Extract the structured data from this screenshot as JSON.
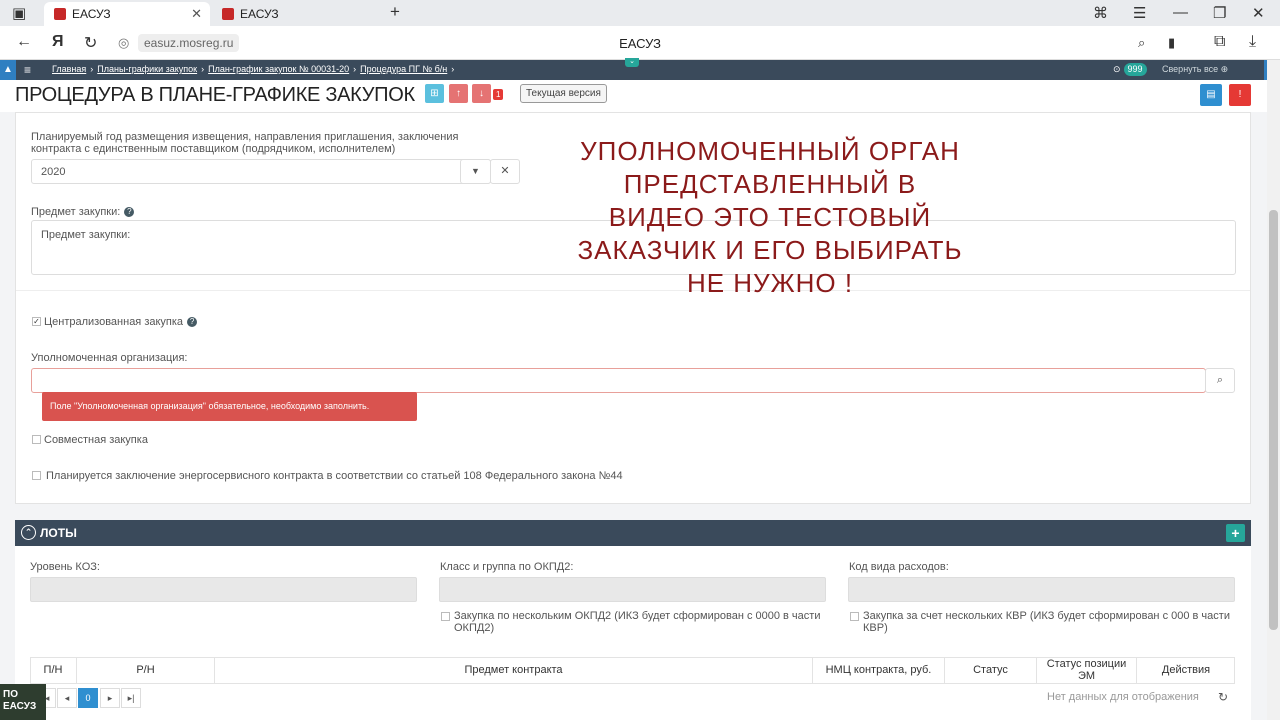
{
  "browser": {
    "tabs": [
      {
        "label": "ЕАСУЗ"
      },
      {
        "label": "ЕАСУЗ"
      }
    ],
    "url": "easuz.mosreg.ru",
    "page_title": "ЕАСУЗ",
    "yandex_label": "Я"
  },
  "appnav": {
    "breadcrumbs": [
      "Главная",
      "Планы-графики закупок",
      "План-график закупок № 00031-20",
      "Процедура ПГ № б/н"
    ],
    "counter": "999",
    "collapse_all": "Свернуть все"
  },
  "header": {
    "title": "ПРОЦЕДУРА В ПЛАНЕ-ГРАФИКЕ ЗАКУПОК",
    "badge_count": "1",
    "version_button": "Текущая версия"
  },
  "form": {
    "year_label": "Планируемый год размещения извещения, направления приглашения, заключения контракта с единственным поставщиком (подрядчиком, исполнителем)",
    "year_value": "2020",
    "subject_label": "Предмет закупки:",
    "subject_placeholder": "Предмет закупки:",
    "centralized_label": "Централизованная закупка",
    "authorized_org_label": "Уполномоченная организация:",
    "error_text": "Поле \"Уполномоченная организация\" обязательное, необходимо заполнить.",
    "joint_label": "Совместная закупка",
    "energy_label": "Планируется заключение энергосервисного контракта в соответствии со статьей 108 Федерального закона №44"
  },
  "overlay_text": [
    "УПОЛНОМОЧЕННЫЙ ОРГАН",
    "ПРЕДСТАВЛЕННЫЙ В",
    "ВИДЕО ЭТО ТЕСТОВЫЙ",
    "ЗАКАЗЧИК И ЕГО ВЫБИРАТЬ",
    "НЕ НУЖНО !"
  ],
  "lots": {
    "title": "ЛОТЫ",
    "koz_label": "Уровень КОЗ:",
    "okpd_label": "Класс и группа по ОКПД2:",
    "expense_label": "Код вида расходов:",
    "okpd_multi": "Закупка по нескольким ОКПД2 (ИКЗ будет сформирован с 0000 в части ОКПД2)",
    "kvr_multi": "Закупка за счет нескольких КВР (ИКЗ будет сформирован с 000 в части КВР)",
    "columns": [
      "П/Н",
      "Р/Н",
      "Предмет контракта",
      "НМЦ контракта, руб.",
      "Статус",
      "Статус позиции ЭМ",
      "Действия"
    ],
    "page_number": "0",
    "no_data": "Нет данных для отображения"
  },
  "corner_logo": [
    "ПО",
    "ЕАСУЗ"
  ]
}
